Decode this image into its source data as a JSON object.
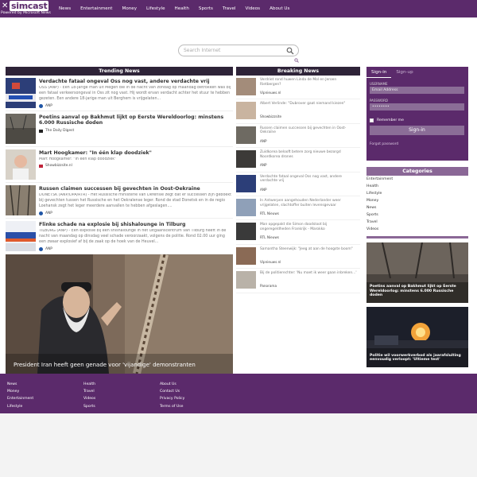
{
  "nav": {
    "logo_name": "simcast",
    "powered_by": "Powered by Microsoft News",
    "items": [
      "News",
      "Entertainment",
      "Money",
      "Lifestyle",
      "Health",
      "Sports",
      "Travel",
      "Videos",
      "About Us"
    ]
  },
  "search": {
    "placeholder": "Search Internet"
  },
  "trending": {
    "heading": "Trending News",
    "articles": [
      {
        "title": "Verdachte fataal ongeval Oss nog vast, andere verdachte vrij",
        "desc": "OSS (ANP) - Een 18-jarige man uit Megen die in de nacht van zondag op maandag betrokken was bij een fataal verkeersongeval in Oss zit nog vast. Hij wordt ervan verdacht achter het stuur te hebben gezeten. Een andere 18-jarige man uit Berghem is vrijgelaten...",
        "source": "ANP"
      },
      {
        "title": "Poetins aanval op Bakhmut lijkt op Eerste Wereldoorlog: minstens 6.000 Russische doden",
        "desc": "",
        "source": "The Daily Digest"
      },
      {
        "title": "Mart Hoogkamer: \"In één klap doodziek\"",
        "desc": "Mart Hoogkamer: \"In één klap doodziek\"",
        "source": "Showbizzsite.nl"
      },
      {
        "title": "Russen claimen successen bij gevechten in Oost-Oekraïne",
        "desc": "DONETSK (ANP/DPA/RTR) - Het Russische ministerie van Defensie zegt dat er successen zijn geboekt bij gevechten tussen het Russische en het Oekraïense leger. Rond de stad Donetsk en in de regio Loehansk zegt het leger meerdere aanvallen te hebben afgeslagen....",
        "source": "ANP"
      },
      {
        "title": "Flinke schade na explosie bij shishalounge in Tilburg",
        "desc": "TILBURG (ANP) - Een explosie bij een shishalounge in het uitgaanscentrum van Tilburg heeft in de nacht van maandag op dinsdag veel schade veroorzaakt, volgens de politie. Rond 02.00 uur ging een zwaar explosief af bij de zaak op de hoek van de Heuvel...",
        "source": "ANP"
      }
    ],
    "hero_caption": "President Iran heeft geen genade voor 'vijandige' demonstranten"
  },
  "breaking": {
    "heading": "Breaking News",
    "items": [
      {
        "text": "Verdriet rond huwen Linda de Mol en Jeroen Rietbergen?",
        "source": "Vipnieuws.nl"
      },
      {
        "text": "Albert Verlinde: \"Dubrover gaat niemand kiezen\"",
        "source": "Showbizzsite"
      },
      {
        "text": "Russen claimen successen bij gevechten in Oost-Oekraïne",
        "source": "ANP"
      },
      {
        "text": "Zuidkorea belooft betere zorg nieuwe bezorgd Noordkorea drones",
        "source": "ANP"
      },
      {
        "text": "Verdachte fataal ongeval Oss nog vast, andere verdachte vrij",
        "source": "ANP"
      },
      {
        "text": "In Antwerpen aangehouden Nederlander weer vrijgelaten, slachtoffer buiten levensgevaar",
        "source": "RTL Nieuws"
      },
      {
        "text": "Man opgepakt die Simon doodsloot bij ongeregeldheden Frankrijk - Marokko",
        "source": "RTL Nieuws"
      },
      {
        "text": "Samantha Steenwijk: \"Jeeg at aan de hoogste boom\"",
        "source": "Vipnieuws.nl"
      },
      {
        "text": "Bij de politierechter: 'Nu moet ik weer gaan inbreken...'",
        "source": "Panorama"
      }
    ]
  },
  "login": {
    "tab_signin": "Sign-in",
    "tab_signup": "Sign-up",
    "username_label": "USERNAME",
    "username_placeholder": "Email Address",
    "password_label": "PASSWORD",
    "password_value": "••••••••",
    "remember": "Remember me",
    "signin_button": "Sign-in",
    "forgot": "Forgot password"
  },
  "categories": {
    "heading": "Categories",
    "items": [
      "Entertainment",
      "Health",
      "Lifestyle",
      "Money",
      "News",
      "Sports",
      "Travel",
      "Videos"
    ]
  },
  "right_images": [
    {
      "caption": "Poetins aanval op Bakhmut lijkt op Eerste Wereldoorlog: minstens 6.000 Russische doden"
    },
    {
      "caption": "Politie wil voorwerkverbod als jaarafsluiting eenvoudig verloopt: 'Ultieme test'"
    }
  ],
  "footer": {
    "col1": [
      "News",
      "Money",
      "Entertainment",
      "Lifestyle"
    ],
    "col2": [
      "Health",
      "Travel",
      "Videos",
      "Sports"
    ],
    "col3": [
      "About Us",
      "Contact Us",
      "Privacy Policy",
      "Terms of Use"
    ]
  }
}
